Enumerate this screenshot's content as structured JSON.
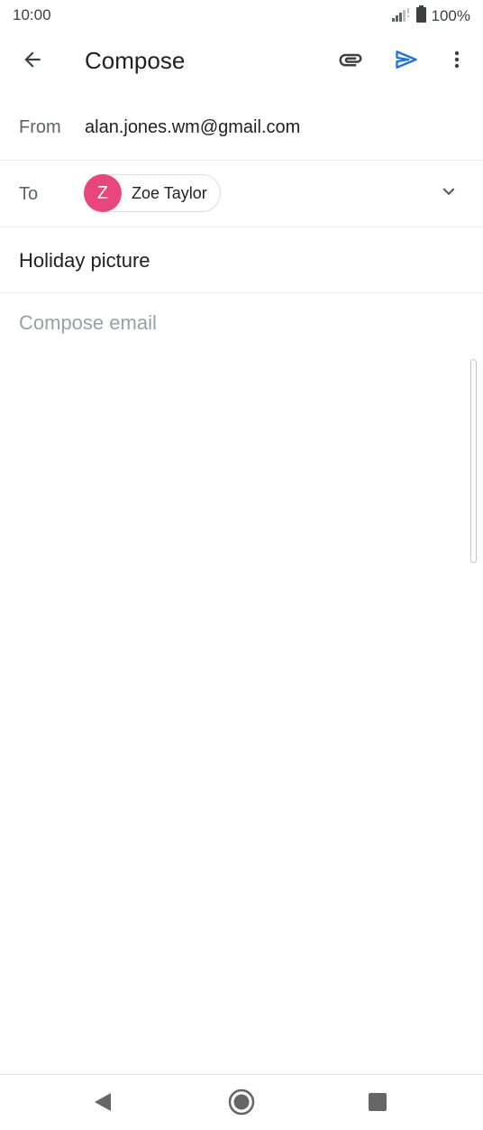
{
  "status_bar": {
    "time": "10:00",
    "battery": "100%",
    "icons": [
      "signal-icon",
      "battery-icon"
    ]
  },
  "app_bar": {
    "title": "Compose",
    "icons": [
      "back-arrow-icon",
      "paperclip-icon",
      "send-icon",
      "more-vert-icon"
    ],
    "send_color": "#1a73e8"
  },
  "compose": {
    "from_label": "From",
    "from_value": "alan.jones.wm@gmail.com",
    "to_label": "To",
    "recipient": {
      "initial": "Z",
      "name": "Zoe Taylor",
      "avatar_color": "#e8457a"
    },
    "subject": "Holiday picture",
    "body_placeholder": "Compose email"
  },
  "nav_bar": {
    "icons": [
      "nav-back-icon",
      "nav-home-icon",
      "nav-recents-icon"
    ]
  }
}
